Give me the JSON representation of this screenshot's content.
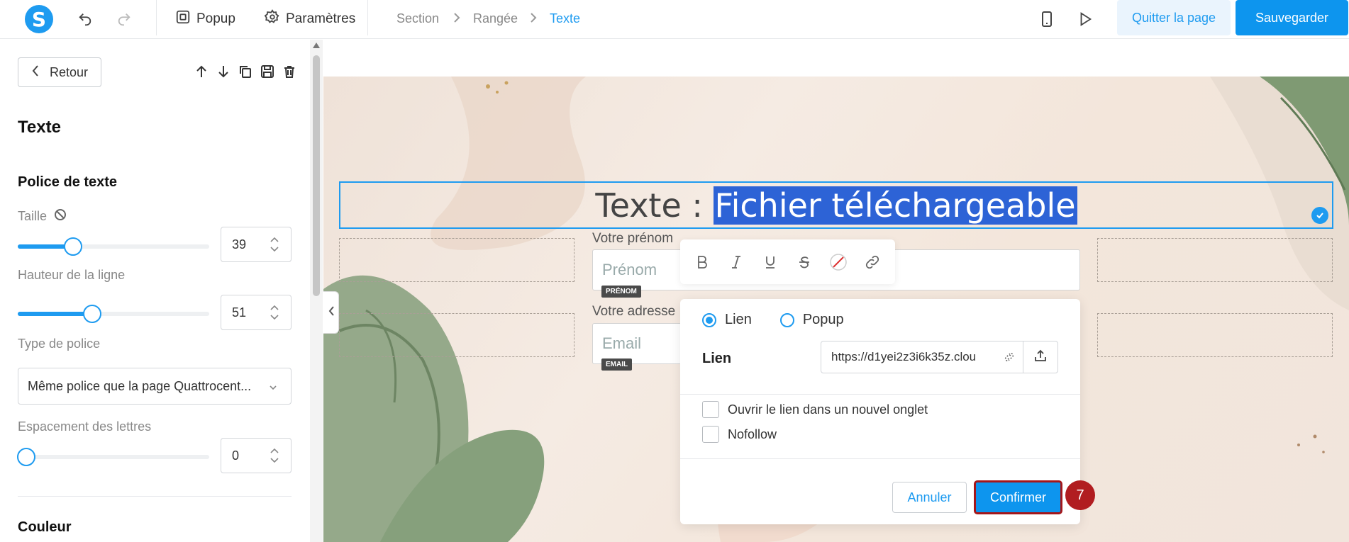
{
  "topbar": {
    "popup_label": "Popup",
    "settings_label": "Paramètres",
    "breadcrumb": [
      "Section",
      "Rangée",
      "Texte"
    ],
    "quit_label": "Quitter la page",
    "save_label": "Sauvegarder"
  },
  "panel": {
    "back_label": "Retour",
    "title": "Texte",
    "font_section": "Police de texte",
    "size_label": "Taille",
    "size_value": "39",
    "size_fraction": 0.29,
    "line_height_label": "Hauteur de la ligne",
    "line_height_value": "51",
    "line_height_fraction": 0.39,
    "font_type_label": "Type de police",
    "font_type_value": "Même police que la page Quattrocent...",
    "letter_spacing_label": "Espacement des lettres",
    "letter_spacing_value": "0",
    "letter_spacing_fraction": 0.0,
    "color_section": "Couleur"
  },
  "canvas": {
    "headline_prefix": "Texte : ",
    "headline_selected": "Fichier téléchargeable",
    "firstname_label": "Votre prénom",
    "firstname_placeholder": "Prénom",
    "firstname_tag": "PRÉNOM",
    "email_label": "Votre adresse",
    "email_placeholder": "Email",
    "email_tag": "EMAIL"
  },
  "link_modal": {
    "option_link": "Lien",
    "option_popup": "Popup",
    "link_label": "Lien",
    "link_value": "https://d1yei2z3i6k35z.clou",
    "new_tab_label": "Ouvrir le lien dans un nouvel onglet",
    "nofollow_label": "Nofollow",
    "cancel_label": "Annuler",
    "confirm_label": "Confirmer"
  },
  "step_badge": "7",
  "colors": {
    "accent": "#1e9bf0",
    "selection": "#2d63d6",
    "highlight_border": "#a4161a"
  }
}
